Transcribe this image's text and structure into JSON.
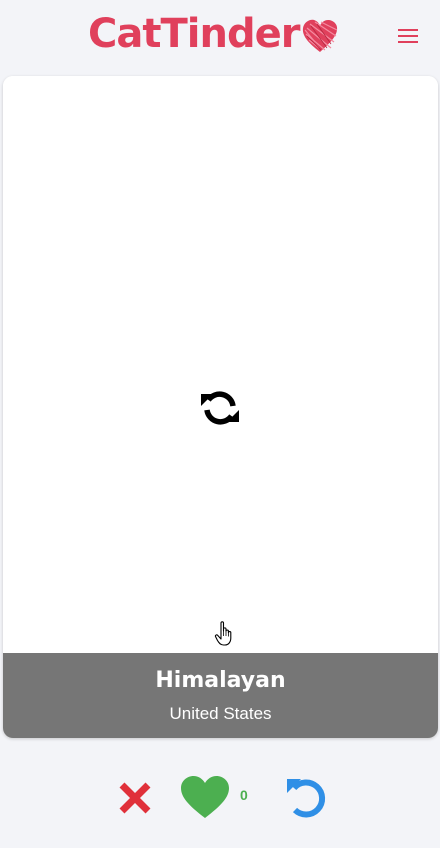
{
  "header": {
    "logo_text": "CatTinder",
    "logo_icon": "heart-icon",
    "menu_icon": "hamburger-menu-icon"
  },
  "card": {
    "loading_icon": "refresh-icon",
    "cat_name": "Himalayan",
    "cat_origin": "United States"
  },
  "actions": {
    "dislike_icon": "close-icon",
    "like_icon": "heart-icon",
    "like_count": "0",
    "undo_icon": "undo-icon"
  },
  "colors": {
    "brand": "#e0405c",
    "dislike": "#e0303a",
    "like": "#4caf50",
    "undo": "#2f8fe6",
    "card_footer": "#767676",
    "background": "#f3f4f8"
  }
}
